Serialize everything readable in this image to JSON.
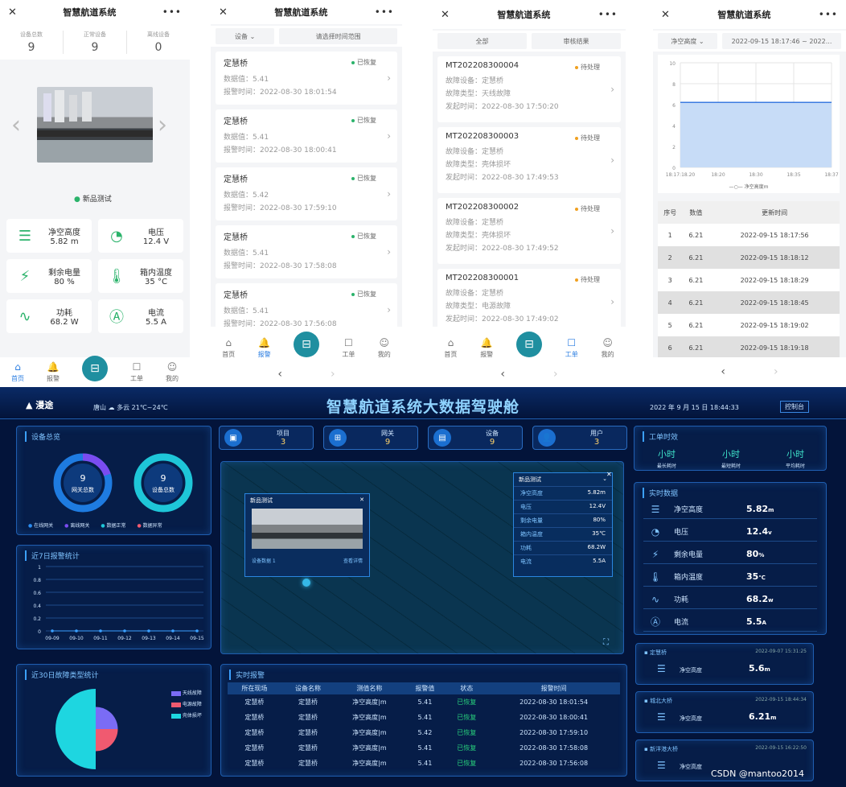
{
  "app_title": "智慧航道系统",
  "phone1": {
    "stats": [
      {
        "label": "设备总数",
        "value": "9"
      },
      {
        "label": "正常设备",
        "value": "9"
      },
      {
        "label": "离线设备",
        "value": "0"
      }
    ],
    "camera_label": "新品测试",
    "metrics": [
      {
        "name": "净空高度",
        "value": "5.82 m"
      },
      {
        "name": "电压",
        "value": "12.4 V"
      },
      {
        "name": "剩余电量",
        "value": "80 %"
      },
      {
        "name": "箱内温度",
        "value": "35 °C"
      },
      {
        "name": "功耗",
        "value": "68.2 W"
      },
      {
        "name": "电流",
        "value": "5.5 A"
      }
    ],
    "tabs": [
      "首页",
      "报警",
      "",
      "工单",
      "我的"
    ]
  },
  "phone2": {
    "filter": {
      "device": "设备",
      "date": "请选择时间范围"
    },
    "alarms": [
      {
        "title": "定慧桥",
        "status": "已恢复",
        "value": "数据值：5.41",
        "time": "报警时间：2022-08-30 18:01:54"
      },
      {
        "title": "定慧桥",
        "status": "已恢复",
        "value": "数据值：5.41",
        "time": "报警时间：2022-08-30 18:00:41"
      },
      {
        "title": "定慧桥",
        "status": "已恢复",
        "value": "数据值：5.42",
        "time": "报警时间：2022-08-30 17:59:10"
      },
      {
        "title": "定慧桥",
        "status": "已恢复",
        "value": "数据值：5.41",
        "time": "报警时间：2022-08-30 17:58:08"
      },
      {
        "title": "定慧桥",
        "status": "已恢复",
        "value": "数据值：5.41",
        "time": "报警时间：2022-08-30 17:56:08"
      }
    ],
    "tabs": [
      "首页",
      "报警",
      "",
      "工单",
      "我的"
    ]
  },
  "phone3": {
    "filter": {
      "all": "全部",
      "result": "审核结果"
    },
    "orders": [
      {
        "id": "MT202208300004",
        "status": "待处理",
        "device": "故障设备：定慧桥",
        "type": "故障类型：天线故障",
        "time": "发起时间：2022-08-30 17:50:20"
      },
      {
        "id": "MT202208300003",
        "status": "待处理",
        "device": "故障设备：定慧桥",
        "type": "故障类型：壳体损坏",
        "time": "发起时间：2022-08-30 17:49:53"
      },
      {
        "id": "MT202208300002",
        "status": "待处理",
        "device": "故障设备：定慧桥",
        "type": "故障类型：壳体损坏",
        "time": "发起时间：2022-08-30 17:49:52"
      },
      {
        "id": "MT202208300001",
        "status": "待处理",
        "device": "故障设备：定慧桥",
        "type": "故障类型：电源故障",
        "time": "发起时间：2022-08-30 17:49:02"
      }
    ],
    "tabs": [
      "首页",
      "报警",
      "",
      "工单",
      "我的"
    ]
  },
  "phone4": {
    "filter": {
      "metric": "净空高度",
      "range": "2022-09-15 18:17:46 ~ 2022..."
    },
    "chart_data": {
      "type": "area",
      "x": [
        "18:17:18.20",
        "18:20",
        "18:30",
        "18:35",
        "18:37"
      ],
      "y_ticks": [
        "10",
        "8",
        "6",
        "4",
        "2",
        "0"
      ],
      "ylim": [
        0,
        10
      ],
      "series": [
        {
          "name": "净空高度m",
          "values": [
            6.21,
            6.21,
            6.21,
            6.21,
            6.21
          ]
        }
      ]
    },
    "table_headers": [
      "序号",
      "数值",
      "更新时间"
    ],
    "rows": [
      [
        "1",
        "6.21",
        "2022-09-15 18:17:56"
      ],
      [
        "2",
        "6.21",
        "2022-09-15 18:18:12"
      ],
      [
        "3",
        "6.21",
        "2022-09-15 18:18:29"
      ],
      [
        "4",
        "6.21",
        "2022-09-15 18:18:45"
      ],
      [
        "5",
        "6.21",
        "2022-09-15 18:19:02"
      ],
      [
        "6",
        "6.21",
        "2022-09-15 18:19:18"
      ]
    ]
  },
  "dash": {
    "logo": "漫途",
    "weather": "唐山 ☁ 多云 21℃~24℃",
    "title": "智慧航道系统大数据驾驶舱",
    "datetime": "2022 年 9 月 15 日 18:44:33",
    "console": "控制台",
    "device_overview": "设备总览",
    "gw_total": "9",
    "gw_label": "网关总数",
    "dev_total": "9",
    "dev_label": "设备总数",
    "legend1": [
      "在线网关",
      "离线网关",
      "数据正常",
      "数据异常"
    ],
    "top_stats": [
      {
        "label": "项目",
        "value": "3"
      },
      {
        "label": "网关",
        "value": "9"
      },
      {
        "label": "设备",
        "value": "9"
      },
      {
        "label": "用户",
        "value": "3"
      }
    ],
    "work_time": "工单时效",
    "time_cols": [
      {
        "v": "小时",
        "l": "最长耗时"
      },
      {
        "v": "小时",
        "l": "最短耗时"
      },
      {
        "v": "小时",
        "l": "平均耗时"
      }
    ],
    "alarm7_title": "近7日报警统计",
    "alarm7": {
      "type": "line",
      "categories": [
        "09-09",
        "09-10",
        "09-11",
        "09-12",
        "09-13",
        "09-14",
        "09-15"
      ],
      "y_ticks": [
        "1",
        "0.8",
        "0.6",
        "0.4",
        "0.2",
        "0"
      ],
      "values": [
        0,
        0,
        0,
        0,
        0,
        0,
        0
      ]
    },
    "fault_title": "近30日故障类型统计",
    "fault_legend": [
      "天线故障",
      "电源故障",
      "壳体损坏"
    ],
    "fault_pie": {
      "type": "pie",
      "labels": [
        "天线故障",
        "电源故障",
        "壳体损坏"
      ],
      "values": [
        1,
        1,
        2
      ]
    },
    "popup": {
      "title": "新品测试",
      "gateway": "设备数据 1",
      "more": "查看详情"
    },
    "info_box": {
      "title": "新品测试",
      "rows": [
        [
          "净空高度",
          "5.82m"
        ],
        [
          "电压",
          "12.4V"
        ],
        [
          "剩余电量",
          "80%"
        ],
        [
          "箱内温度",
          "35℃"
        ],
        [
          "功耗",
          "68.2W"
        ],
        [
          "电流",
          "5.5A"
        ]
      ]
    },
    "realtime_title": "实时数据",
    "realtime": [
      [
        "净空高度",
        "5.82",
        "m"
      ],
      [
        "电压",
        "12.4",
        "v"
      ],
      [
        "剩余电量",
        "80",
        "%"
      ],
      [
        "箱内温度",
        "35",
        "℃"
      ],
      [
        "功耗",
        "68.2",
        "w"
      ],
      [
        "电流",
        "5.5",
        "A"
      ]
    ],
    "cards": [
      {
        "name": "定慧桥",
        "time": "2022-09-07 15:31:25",
        "metric": "净空高度",
        "value": "5.6",
        "unit": "m"
      },
      {
        "name": "城北大桥",
        "time": "2022-09-15 18:44:34",
        "metric": "净空高度",
        "value": "6.21",
        "unit": "m"
      },
      {
        "name": "新洋港大桥",
        "time": "2022-09-15 16:22:50",
        "metric": "净空高度",
        "value": "",
        "unit": ""
      }
    ],
    "alarm_title": "实时报警",
    "alarm_headers": [
      "所在现场",
      "设备名称",
      "测值名称",
      "报警值",
      "状态",
      "报警时间"
    ],
    "alarm_rows": [
      [
        "定慧桥",
        "定慧桥",
        "净空高度|m",
        "5.41",
        "已恢复",
        "2022-08-30 18:01:54"
      ],
      [
        "定慧桥",
        "定慧桥",
        "净空高度|m",
        "5.41",
        "已恢复",
        "2022-08-30 18:00:41"
      ],
      [
        "定慧桥",
        "定慧桥",
        "净空高度|m",
        "5.42",
        "已恢复",
        "2022-08-30 17:59:10"
      ],
      [
        "定慧桥",
        "定慧桥",
        "净空高度|m",
        "5.41",
        "已恢复",
        "2022-08-30 17:58:08"
      ],
      [
        "定慧桥",
        "定慧桥",
        "净空高度|m",
        "5.41",
        "已恢复",
        "2022-08-30 17:56:08"
      ]
    ],
    "watermark": "CSDN @mantoo2014"
  }
}
